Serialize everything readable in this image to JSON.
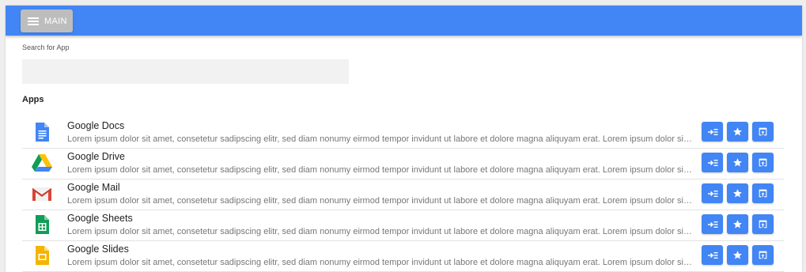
{
  "topbar": {
    "main_label": "MAIN",
    "color": "#4285f4"
  },
  "search": {
    "label": "Search for App",
    "value": "",
    "placeholder": ""
  },
  "apps_section": {
    "title": "Apps"
  },
  "apps": [
    {
      "name": "Google Docs",
      "icon": "google-docs-icon",
      "description": "Lorem ipsum dolor sit amet, consetetur sadipscing elitr, sed diam nonumy eirmod tempor invidunt ut labore et dolore magna aliquyam erat. Lorem ipsum dolor sit amet, consetetur sadipscing elitr."
    },
    {
      "name": "Google Drive",
      "icon": "google-drive-icon",
      "description": "Lorem ipsum dolor sit amet, consetetur sadipscing elitr, sed diam nonumy eirmod tempor invidunt ut labore et dolore magna aliquyam erat. Lorem ipsum dolor sit amet, consetetur sadipscing elitr."
    },
    {
      "name": "Google Mail",
      "icon": "google-mail-icon",
      "description": "Lorem ipsum dolor sit amet, consetetur sadipscing elitr, sed diam nonumy eirmod tempor invidunt ut labore et dolore magna aliquyam erat. Lorem ipsum dolor sit amet, consetetur sadipscing elitr."
    },
    {
      "name": "Google Sheets",
      "icon": "google-sheets-icon",
      "description": "Lorem ipsum dolor sit amet, consetetur sadipscing elitr, sed diam nonumy eirmod tempor invidunt ut labore et dolore magna aliquyam erat. Lorem ipsum dolor sit amet, consetetur sadipscing elitr."
    },
    {
      "name": "Google Slides",
      "icon": "google-slides-icon",
      "description": "Lorem ipsum dolor sit amet, consetetur sadipscing elitr, sed diam nonumy eirmod tempor invidunt ut labore et dolore magna aliquyam erat. Lorem ipsum dolor sit amet, consetetur sadipscing elitr."
    }
  ],
  "row_actions": [
    {
      "name": "add-to-menu-button",
      "icon": "playlist-add-icon"
    },
    {
      "name": "favorite-button",
      "icon": "star-icon"
    },
    {
      "name": "open-button",
      "icon": "open-in-browser-icon"
    }
  ]
}
